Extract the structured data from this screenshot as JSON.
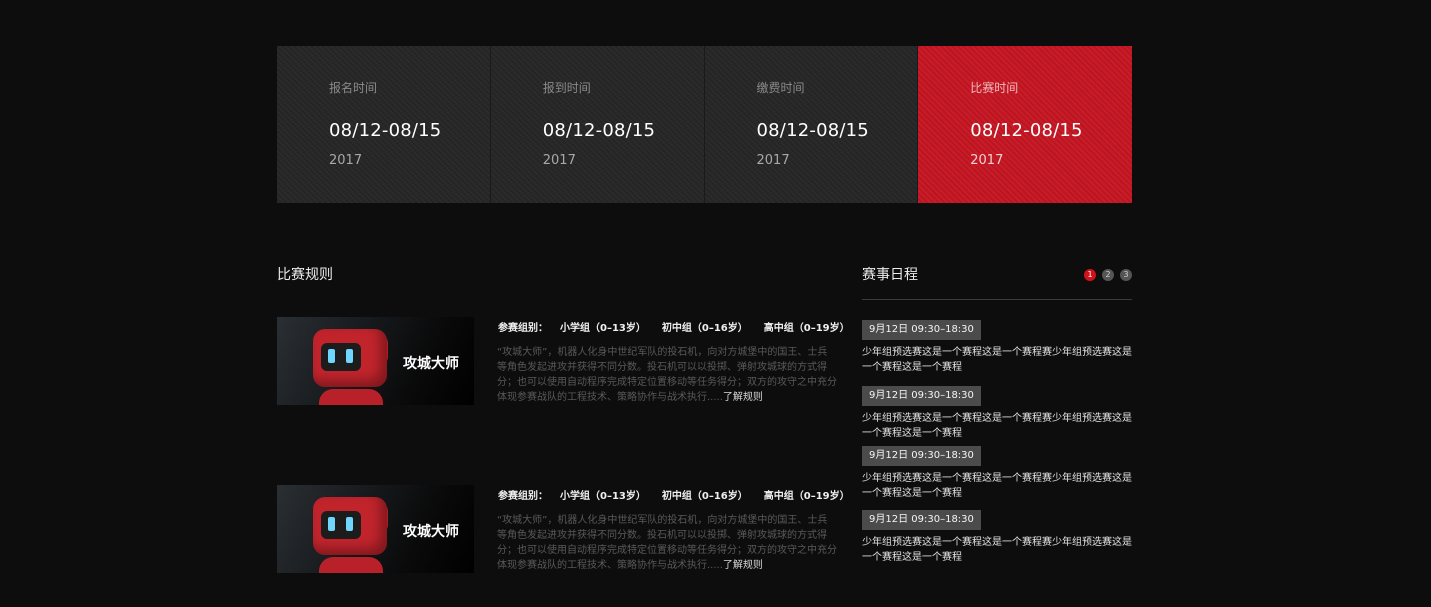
{
  "timeline": [
    {
      "label": "报名时间",
      "date": "08/12-08/15",
      "year": "2017",
      "active": false
    },
    {
      "label": "报到时间",
      "date": "08/12-08/15",
      "year": "2017",
      "active": false
    },
    {
      "label": "缴费时间",
      "date": "08/12-08/15",
      "year": "2017",
      "active": false
    },
    {
      "label": "比赛时间",
      "date": "08/12-08/15",
      "year": "2017",
      "active": true
    }
  ],
  "rules": {
    "title": "比赛规则",
    "items": [
      {
        "thumb_title": "攻城大师",
        "groups": [
          "参赛组别：",
          "小学组（0–13岁）",
          "初中组（0–16岁）",
          "高中组（0–19岁）"
        ],
        "description": "“攻城大师”，机器人化身中世纪军队的投石机，向对方城堡中的国王、士兵等角色发起进攻并获得不同分数。投石机可以以投掷、弹射攻城球的方式得分；也可以使用自动程序完成特定位置移动等任务得分；双方的攻守之中充分体现参赛战队的工程技术、策略协作与战术执行.....",
        "more": "了解规则"
      },
      {
        "thumb_title": "攻城大师",
        "groups": [
          "参赛组别：",
          "小学组（0–13岁）",
          "初中组（0–16岁）",
          "高中组（0–19岁）"
        ],
        "description": "“攻城大师”，机器人化身中世纪军队的投石机，向对方城堡中的国王、士兵等角色发起进攻并获得不同分数。投石机可以以投掷、弹射攻城球的方式得分；也可以使用自动程序完成特定位置移动等任务得分；双方的攻守之中充分体现参赛战队的工程技术、策略协作与战术执行.....",
        "more": "了解规则"
      }
    ]
  },
  "schedule": {
    "title": "赛事日程",
    "pages": [
      "1",
      "2",
      "3"
    ],
    "current_page": "1",
    "items": [
      {
        "time": "9月12日  09:30–18:30",
        "text": "少年组预选赛这是一个赛程这是一个赛程赛少年组预选赛这是一个赛程这是一个赛程"
      },
      {
        "time": "9月12日  09:30–18:30",
        "text": "少年组预选赛这是一个赛程这是一个赛程赛少年组预选赛这是一个赛程这是一个赛程"
      },
      {
        "time": "9月12日  09:30–18:30",
        "text": "少年组预选赛这是一个赛程这是一个赛程赛少年组预选赛这是一个赛程这是一个赛程"
      },
      {
        "time": "9月12日  09:30–18:30",
        "text": "少年组预选赛这是一个赛程这是一个赛程赛少年组预选赛这是一个赛程这是一个赛程"
      }
    ]
  },
  "colors": {
    "accent": "#c41622",
    "background": "#0d0d0d",
    "card": "#262626"
  }
}
